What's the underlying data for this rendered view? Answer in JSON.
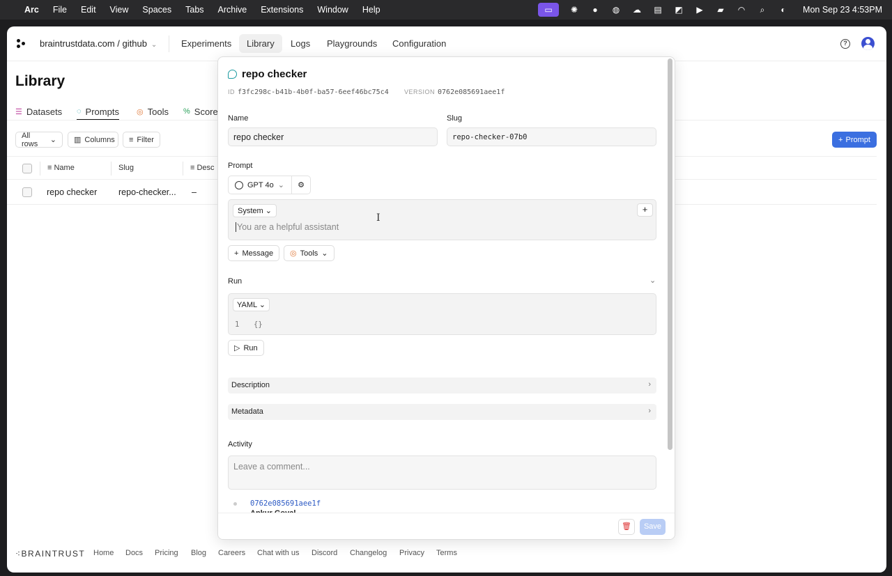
{
  "menubar": {
    "app": "Arc",
    "items": [
      "File",
      "Edit",
      "View",
      "Spaces",
      "Tabs",
      "Archive",
      "Extensions",
      "Window",
      "Help"
    ],
    "clock": "Mon Sep 23  4:53PM"
  },
  "nav": {
    "org": "braintrustdata.com / github",
    "tabs": [
      "Experiments",
      "Library",
      "Logs",
      "Playgrounds",
      "Configuration"
    ],
    "active_tab": "Library"
  },
  "library": {
    "title": "Library",
    "tabs": [
      "Datasets",
      "Prompts",
      "Tools",
      "Score"
    ],
    "filters": [
      "All rows",
      "Columns",
      "Filter"
    ],
    "new_button": "Prompt",
    "columns": [
      "Name",
      "Slug",
      "Desc"
    ],
    "rows": [
      {
        "name": "repo checker",
        "slug": "repo-checker...",
        "desc": "–"
      }
    ]
  },
  "panel": {
    "title": "repo checker",
    "id_label": "ID",
    "id": "f3fc298c-b41b-4b0f-ba57-6eef46bc75c4",
    "version_label": "VERSION",
    "version": "0762e085691aee1f",
    "name_label": "Name",
    "name_value": "repo checker",
    "slug_label": "Slug",
    "slug_value": "repo-checker-07b0",
    "prompt_label": "Prompt",
    "model": "GPT 4o",
    "role": "System",
    "message_placeholder": "You are a helpful assistant",
    "add_message": "Message",
    "tools": "Tools",
    "run_label": "Run",
    "format": "YAML",
    "code_line": "1",
    "code_value": "{}",
    "run_button": "Run",
    "description": "Description",
    "metadata": "Metadata",
    "activity": "Activity",
    "comment_placeholder": "Leave a comment...",
    "activity_version": "0762e085691aee1f",
    "activity_author": "Ankur Goyal",
    "save": "Save"
  },
  "footer": {
    "logo": "BRAINTRUST",
    "links": [
      "Home",
      "Docs",
      "Pricing",
      "Blog",
      "Careers",
      "Chat with us",
      "Discord",
      "Changelog",
      "Privacy",
      "Terms"
    ]
  },
  "colors": {
    "accent": "#3b6fe0",
    "highlight": "#7a55e8"
  }
}
